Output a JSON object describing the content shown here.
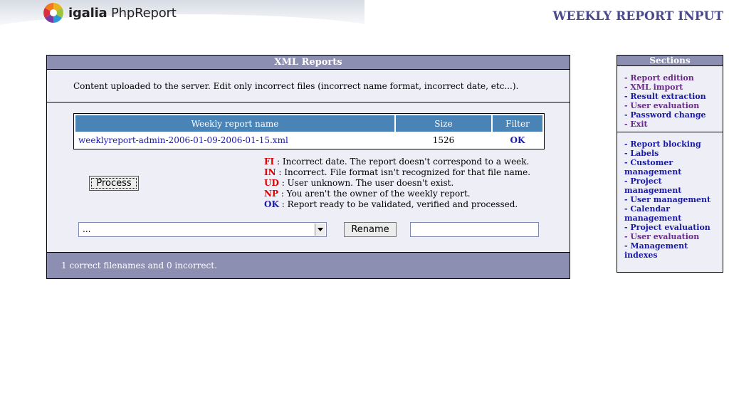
{
  "header": {
    "logo_brand": "igalia",
    "logo_product": "PhpReport",
    "page_title": "WEEKLY REPORT INPUT"
  },
  "main": {
    "title": "XML Reports",
    "intro": "Content uploaded to the server. Edit only incorrect files (incorrect name format, incorrect date, etc...).",
    "table": {
      "columns": [
        "Weekly report name",
        "Size",
        "Filter"
      ],
      "rows": [
        {
          "name": "weeklyreport-admin-2006-01-09-2006-01-15.xml",
          "size": "1526",
          "filter": "OK"
        }
      ]
    },
    "process_label": "Process",
    "legend": [
      {
        "code": "FI",
        "text": ": Incorrect date. The report doesn't correspond to a week.",
        "color": "#e00000"
      },
      {
        "code": "IN",
        "text": ": Incorrect. File format isn't recognized for that file name.",
        "color": "#e00000"
      },
      {
        "code": "UD",
        "text": ": User unknown. The user doesn't exist.",
        "color": "#e00000"
      },
      {
        "code": "NP",
        "text": ": You aren't the owner of the weekly report.",
        "color": "#e00000"
      },
      {
        "code": "OK",
        "text": ": Report ready to be validated, verified and processed.",
        "color": "#1a1aa6"
      }
    ],
    "select_value": "...",
    "rename_label": "Rename",
    "rename_value": "",
    "footer": "1 correct filenames and 0 incorrect."
  },
  "sections": {
    "title": "Sections",
    "group1": [
      {
        "label": "- Report edition",
        "visited": true
      },
      {
        "label": "- XML import",
        "visited": true
      },
      {
        "label": "- Result extraction",
        "visited": false
      },
      {
        "label": "- User evaluation",
        "visited": true
      },
      {
        "label": "- Password change",
        "visited": false
      },
      {
        "label": "- Exit",
        "visited": true
      }
    ],
    "group2": [
      {
        "label": "- Report blocking",
        "visited": false
      },
      {
        "label": "- Labels",
        "visited": false
      },
      {
        "label": "- Customer management",
        "visited": false
      },
      {
        "label": "- Project management",
        "visited": false
      },
      {
        "label": "- User management",
        "visited": false
      },
      {
        "label": "- Calendar management",
        "visited": false
      },
      {
        "label": "- Project evaluation",
        "visited": false
      },
      {
        "label": "- User evaluation",
        "visited": true
      },
      {
        "label": "- Management indexes",
        "visited": false
      }
    ]
  },
  "colors": {
    "panel_header": "#8c8fb2",
    "table_header": "#4a84b6",
    "title_text": "#4a4a8a",
    "error_code": "#e00000",
    "ok_code": "#1a1aa6"
  }
}
